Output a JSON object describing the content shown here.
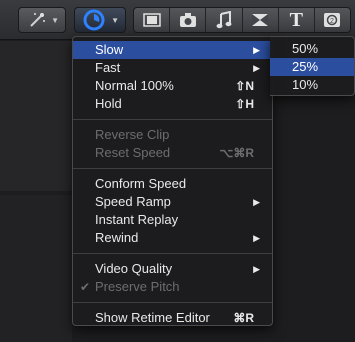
{
  "toolbar": {
    "icons": [
      "magic-wand-icon",
      "retime-icon",
      "filmstrip-icon",
      "camera-icon",
      "music-note-icon",
      "transition-icon",
      "title-icon",
      "generator-icon"
    ],
    "title_glyph": "T"
  },
  "menu": {
    "items": [
      {
        "label": "Slow",
        "shortcut": "",
        "has_submenu": true,
        "selected": true
      },
      {
        "label": "Fast",
        "shortcut": "",
        "has_submenu": true
      },
      {
        "label": "Normal 100%",
        "shortcut": "⇧N"
      },
      {
        "label": "Hold",
        "shortcut": "⇧H"
      },
      {
        "label": "Reverse Clip",
        "shortcut": "",
        "disabled": true
      },
      {
        "label": "Reset Speed",
        "shortcut": "⌥⌘R",
        "disabled": true
      },
      {
        "label": "Conform Speed",
        "shortcut": ""
      },
      {
        "label": "Speed Ramp",
        "shortcut": "",
        "has_submenu": true
      },
      {
        "label": "Instant Replay",
        "shortcut": ""
      },
      {
        "label": "Rewind",
        "shortcut": "",
        "has_submenu": true
      },
      {
        "label": "Video Quality",
        "shortcut": "",
        "has_submenu": true
      },
      {
        "label": "Preserve Pitch",
        "shortcut": "",
        "disabled": true,
        "checked": true
      },
      {
        "label": "Show Retime Editor",
        "shortcut": "⌘R"
      }
    ]
  },
  "submenu": {
    "items": [
      {
        "label": "50%"
      },
      {
        "label": "25%",
        "selected": true
      },
      {
        "label": "10%"
      }
    ]
  },
  "colors": {
    "selection": "#2b4e9f",
    "menu_bg": "#1c1c1e",
    "disabled_text": "#6d6d70"
  }
}
